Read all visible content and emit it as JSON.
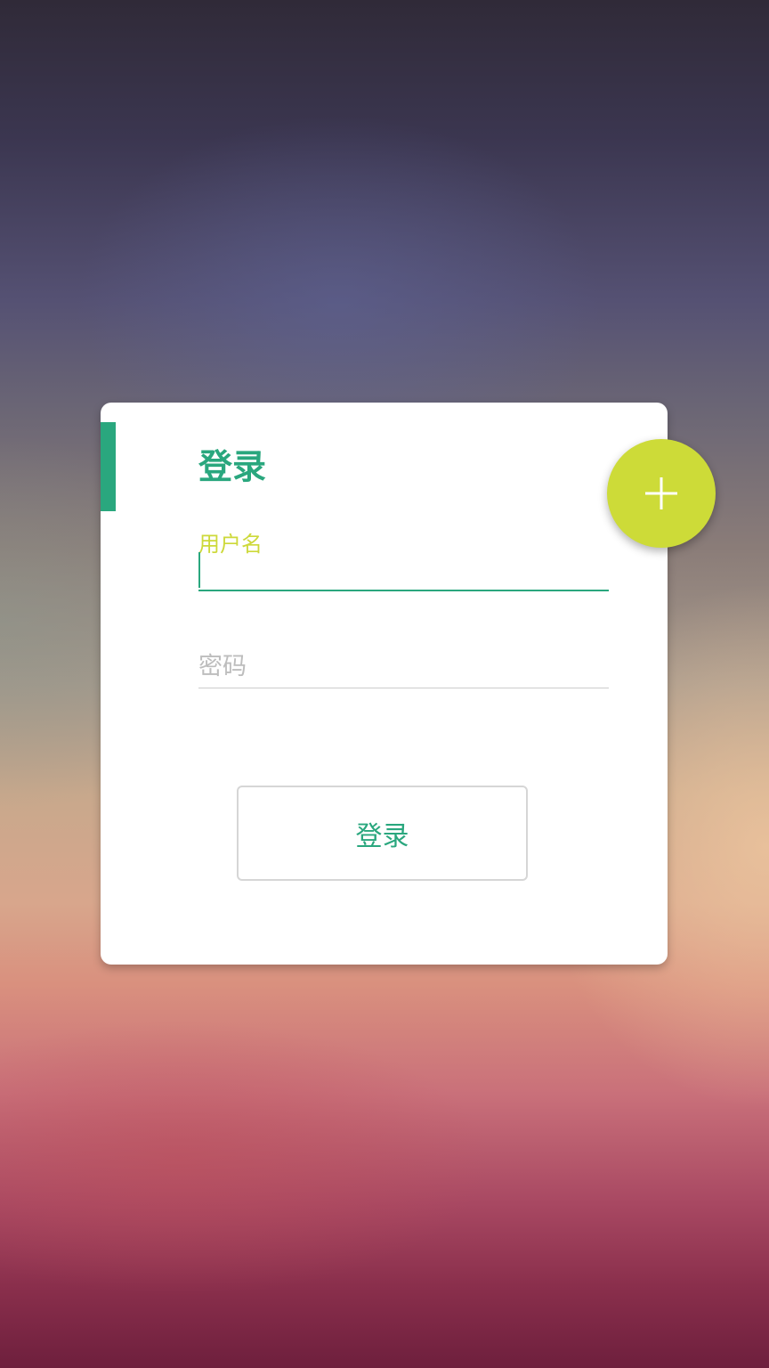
{
  "login_card": {
    "title": "登录",
    "username_label": "用户名",
    "username_value": "",
    "password_placeholder": "密码",
    "submit_label": "登录"
  },
  "fab": {
    "icon": "plus-icon"
  },
  "colors": {
    "accent": "#2aa77e",
    "fab": "#cddb38",
    "label_active": "#cdd93a",
    "placeholder": "#bdbdbd"
  }
}
